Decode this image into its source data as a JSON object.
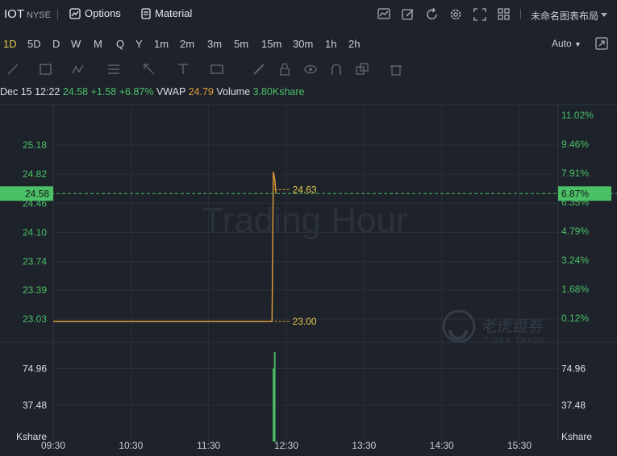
{
  "header": {
    "ticker": "IOT",
    "exchange": "NYSE",
    "options_label": "Options",
    "material_label": "Material",
    "layout_label": "未命名图表布局"
  },
  "intervals": [
    "1D",
    "5D",
    "D",
    "W",
    "M",
    "Q",
    "Y",
    "1m",
    "2m",
    "3m",
    "5m",
    "15m",
    "30m",
    "1h",
    "2h"
  ],
  "active_interval": "1D",
  "scale_mode": "Auto",
  "info": {
    "datetime": "Dec 15 12:22",
    "price": "24.58",
    "change": "+1.58",
    "change_pct": "+6.87%",
    "vwap_label": "VWAP",
    "vwap": "24.79",
    "volume_label": "Volume",
    "volume": "3.80Kshare"
  },
  "watermark": "Trading Hour",
  "brand": {
    "name_cn": "老虎證券",
    "name_en": "TIGER TRADE"
  },
  "colors": {
    "up": "#4cc066",
    "line": "#e3a03a",
    "bg": "#1d222b"
  },
  "chart_data": {
    "type": "line",
    "x_ticks": [
      "09:30",
      "10:30",
      "11:30",
      "12:30",
      "13:30",
      "14:30",
      "15:30"
    ],
    "price_axis_left": [
      "25.18",
      "24.82",
      "24.46",
      "24.10",
      "23.74",
      "23.39",
      "23.03"
    ],
    "price_axis_right": [
      "11.02%",
      "9.46%",
      "7.91%",
      "6.35%",
      "4.79%",
      "3.24%",
      "1.68%",
      "0.12%"
    ],
    "current_price": "24.58",
    "current_pct": "6.87%",
    "annotations": {
      "high": "24.63",
      "low": "23.00"
    },
    "series": [
      {
        "x": [
          "09:30",
          "12:19",
          "12:20",
          "12:21",
          "12:22"
        ],
        "values": [
          23.0,
          23.0,
          24.85,
          24.76,
          24.58
        ]
      }
    ],
    "volume_axis_left": [
      "74.96",
      "37.48"
    ],
    "volume_axis_right": [
      "74.96",
      "37.48"
    ],
    "volume_unit": "Kshare",
    "volume_series": [
      {
        "x": [
          "12:20",
          "12:21"
        ],
        "values": [
          75,
          92
        ]
      }
    ]
  }
}
